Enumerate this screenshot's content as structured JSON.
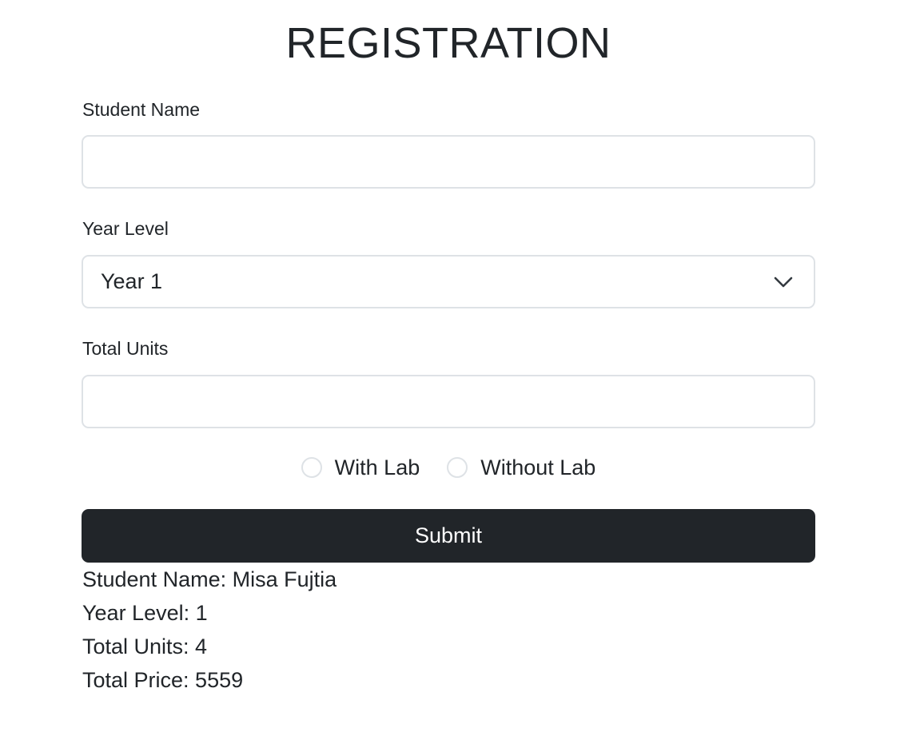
{
  "form": {
    "title": "REGISTRATION",
    "student_name": {
      "label": "Student Name",
      "value": "",
      "placeholder": ""
    },
    "year_level": {
      "label": "Year Level",
      "selected": "Year 1"
    },
    "total_units": {
      "label": "Total Units",
      "value": "",
      "placeholder": ""
    },
    "lab_options": [
      {
        "label": "With Lab",
        "checked": false
      },
      {
        "label": "Without Lab",
        "checked": false
      }
    ],
    "submit_label": "Submit"
  },
  "results": {
    "student_name": "Student Name: Misa Fujtia",
    "year_level": "Year Level: 1",
    "total_units": "Total Units: 4",
    "total_price": "Total Price: 5559"
  },
  "colors": {
    "text": "#212529",
    "border": "#dee2e6",
    "button_bg": "#212529",
    "button_text": "#ffffff"
  },
  "icons": {
    "select": "chevron-down-icon"
  }
}
